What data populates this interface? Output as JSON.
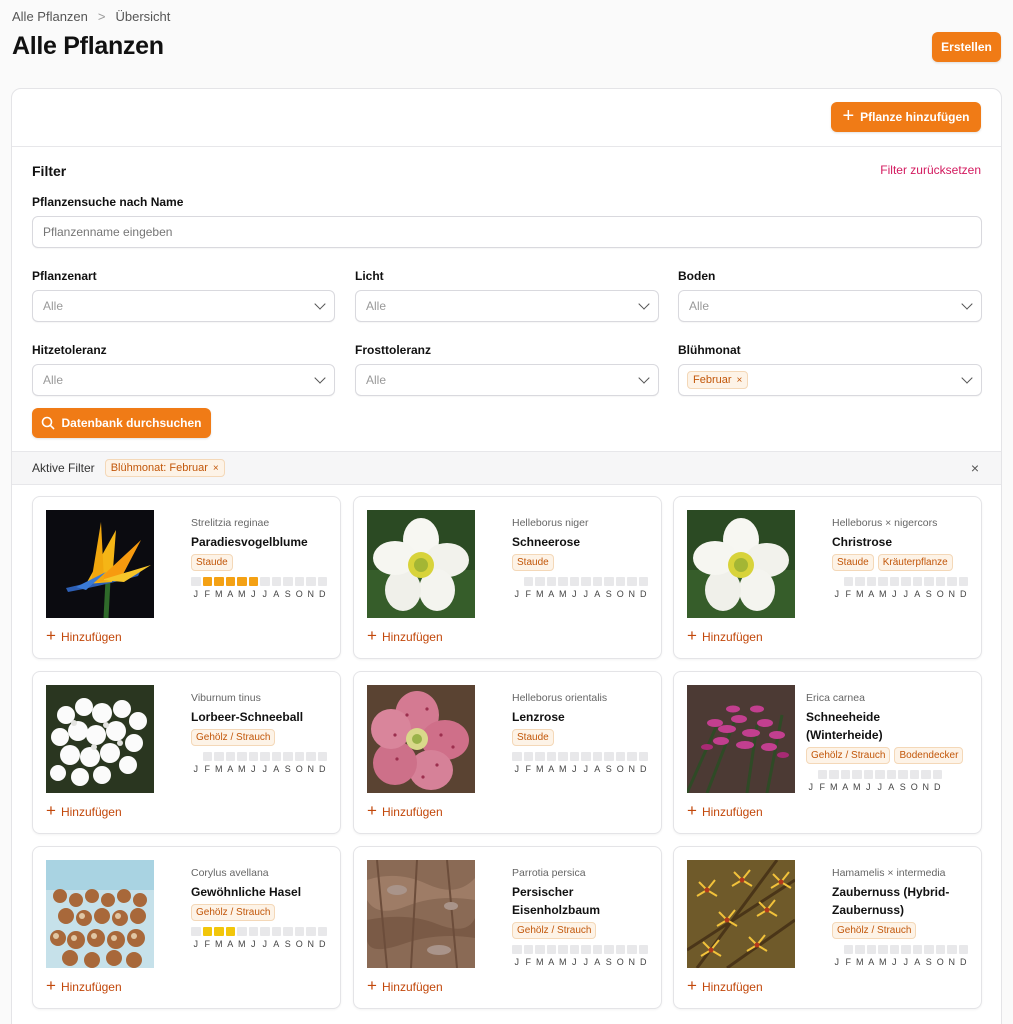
{
  "breadcrumb": {
    "root": "Alle Pflanzen",
    "separator": ">",
    "current": "Übersicht"
  },
  "page_title": "Alle Pflanzen",
  "header": {
    "create_label": "Erstellen"
  },
  "panel": {
    "add_plant_label": "Pflanze hinzufügen"
  },
  "filter": {
    "title": "Filter",
    "reset_label": "Filter zurücksetzen",
    "search_label": "Pflanzensuche nach Name",
    "search_placeholder": "Pflanzenname eingeben",
    "plant_type": {
      "label": "Pflanzenart",
      "value": "Alle"
    },
    "light": {
      "label": "Licht",
      "value": "Alle"
    },
    "soil": {
      "label": "Boden",
      "value": "Alle"
    },
    "heat": {
      "label": "Hitzetoleranz",
      "value": "Alle"
    },
    "frost": {
      "label": "Frosttoleranz",
      "value": "Alle"
    },
    "bloom": {
      "label": "Blühmonat",
      "chip": "Februar",
      "chip_remove": "×"
    },
    "search_button": "Datenbank durchsuchen"
  },
  "active_filters": {
    "label": "Aktive Filter",
    "chip": "Blühmonat: Februar",
    "chip_remove": "×",
    "clear": "×"
  },
  "month_letters": [
    "J",
    "F",
    "M",
    "A",
    "M",
    "J",
    "J",
    "A",
    "S",
    "O",
    "N",
    "D"
  ],
  "add_label": "Hinzufügen",
  "colors": {
    "accent": "#f07b16",
    "reset": "#d3195e",
    "bloom_orange": "#f4a114",
    "bloom_yellow": "#f2c60a"
  },
  "plants": [
    {
      "sci": "Strelitzia reginae",
      "name": "Paradiesvogelblume",
      "tags": [
        "Staude"
      ],
      "image": "strelitzia",
      "bloom": [
        0,
        1,
        1,
        1,
        1,
        1,
        0,
        0,
        0,
        0,
        0,
        0
      ],
      "bloom_color": "orange",
      "first_empty": true
    },
    {
      "sci": "Helleborus niger",
      "name": "Schneerose",
      "tags": [
        "Staude"
      ],
      "image": "hellebore-white",
      "bloom": [
        0,
        0,
        0,
        0,
        0,
        0,
        0,
        0,
        0,
        0,
        0,
        0
      ],
      "bloom_color": "orange",
      "first_empty": false
    },
    {
      "sci": "Helleborus × nigercors",
      "name": "Christrose",
      "tags": [
        "Staude",
        "Kräuterpflanze"
      ],
      "image": "hellebore-white",
      "bloom": [
        0,
        0,
        0,
        0,
        0,
        0,
        0,
        0,
        0,
        0,
        0,
        0
      ],
      "bloom_color": "orange",
      "first_empty": false
    },
    {
      "sci": "Viburnum tinus",
      "name": "Lorbeer-Schneeball",
      "tags": [
        "Gehölz / Strauch"
      ],
      "image": "viburnum",
      "bloom": [
        0,
        0,
        0,
        0,
        0,
        0,
        0,
        0,
        0,
        0,
        0,
        0
      ],
      "bloom_color": "orange",
      "first_empty": false
    },
    {
      "sci": "Helleborus orientalis",
      "name": "Lenzrose",
      "tags": [
        "Staude"
      ],
      "image": "hellebore-pink",
      "bloom": [
        0,
        0,
        0,
        0,
        0,
        0,
        0,
        0,
        0,
        0,
        0,
        0
      ],
      "bloom_color": "orange",
      "first_empty": true
    },
    {
      "sci": "Erica carnea",
      "name": "Schneeheide (Winterheide)",
      "tags": [
        "Gehölz / Strauch",
        "Bodendecker"
      ],
      "image": "erica",
      "bloom": [
        0,
        0,
        0,
        0,
        0,
        0,
        0,
        0,
        0,
        0,
        0,
        0
      ],
      "bloom_color": "orange",
      "first_empty": false
    },
    {
      "sci": "Corylus avellana",
      "name": "Gewöhnliche Hasel",
      "tags": [
        "Gehölz / Strauch"
      ],
      "image": "hazelnut",
      "bloom": [
        0,
        1,
        1,
        1,
        0,
        0,
        0,
        0,
        0,
        0,
        0,
        0
      ],
      "bloom_color": "yellow",
      "first_empty": true
    },
    {
      "sci": "Parrotia persica",
      "name": "Persischer Eisenholzbaum",
      "tags": [
        "Gehölz / Strauch"
      ],
      "image": "bark",
      "bloom": [
        0,
        0,
        0,
        0,
        0,
        0,
        0,
        0,
        0,
        0,
        0,
        0
      ],
      "bloom_color": "orange",
      "first_empty": true
    },
    {
      "sci": "Hamamelis × intermedia",
      "name": "Zaubernuss (Hybrid-Zaubernuss)",
      "tags": [
        "Gehölz / Strauch"
      ],
      "image": "hamamelis",
      "bloom": [
        0,
        0,
        0,
        0,
        0,
        0,
        0,
        0,
        0,
        0,
        0,
        0
      ],
      "bloom_color": "orange",
      "first_empty": false
    }
  ]
}
